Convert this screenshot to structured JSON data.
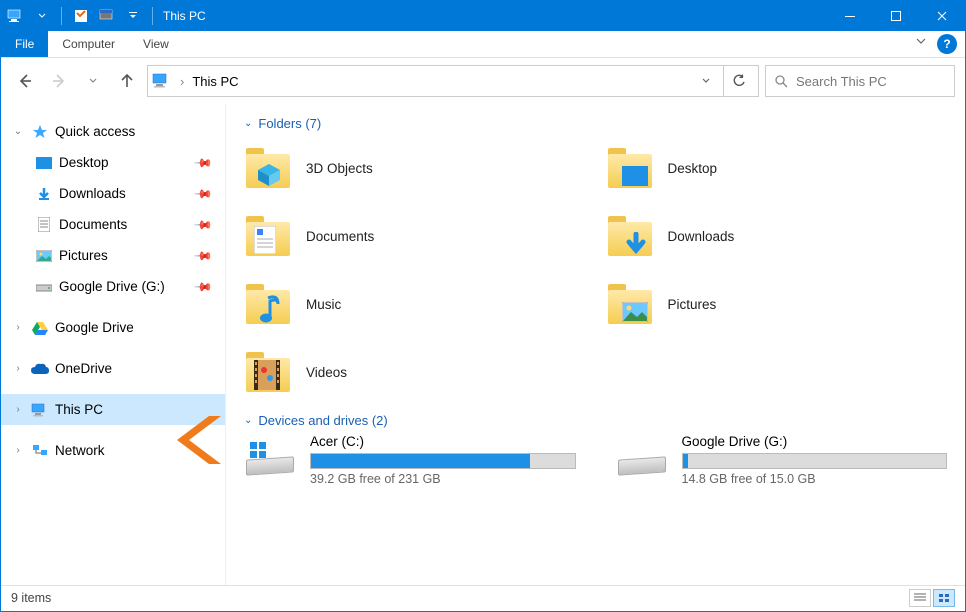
{
  "window": {
    "title": "This PC"
  },
  "ribbon": {
    "tabs": {
      "file": "File",
      "computer": "Computer",
      "view": "View"
    }
  },
  "address": {
    "crumb": "This PC"
  },
  "search": {
    "placeholder": "Search This PC"
  },
  "tree": {
    "quick_access": "Quick access",
    "qa_items": [
      {
        "label": "Desktop"
      },
      {
        "label": "Downloads"
      },
      {
        "label": "Documents"
      },
      {
        "label": "Pictures"
      },
      {
        "label": "Google Drive (G:)"
      }
    ],
    "google_drive": "Google Drive",
    "onedrive": "OneDrive",
    "this_pc": "This PC",
    "network": "Network"
  },
  "groups": {
    "folders": {
      "label": "Folders (7)"
    },
    "drives": {
      "label": "Devices and drives (2)"
    }
  },
  "folders": [
    {
      "label": "3D Objects",
      "overlay": "cube"
    },
    {
      "label": "Desktop",
      "overlay": "desktop"
    },
    {
      "label": "Documents",
      "overlay": "doc"
    },
    {
      "label": "Downloads",
      "overlay": "download"
    },
    {
      "label": "Music",
      "overlay": "music"
    },
    {
      "label": "Pictures",
      "overlay": "picture"
    },
    {
      "label": "Videos",
      "overlay": "video"
    }
  ],
  "drives_list": [
    {
      "name": "Acer (C:)",
      "free_text": "39.2 GB free of 231 GB",
      "used_pct": 83
    },
    {
      "name": "Google Drive (G:)",
      "free_text": "14.8 GB free of 15.0 GB",
      "used_pct": 2
    }
  ],
  "status": {
    "items": "9 items"
  }
}
